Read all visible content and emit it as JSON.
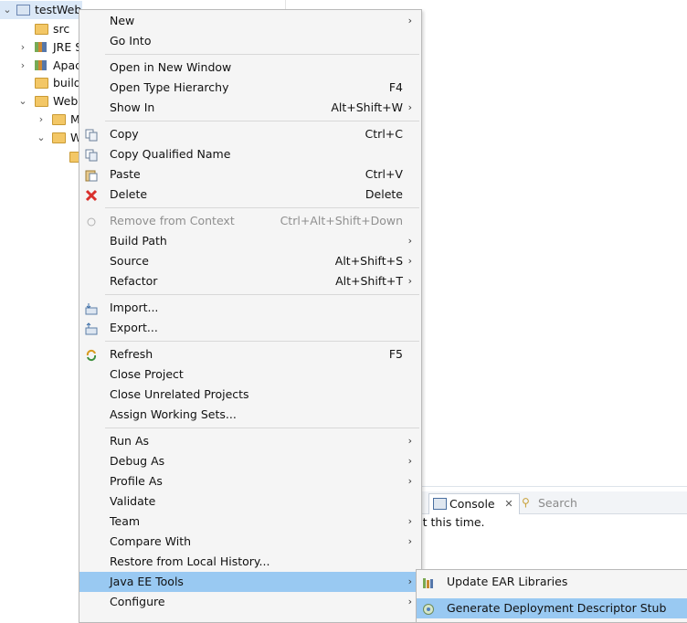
{
  "tree": {
    "items": [
      {
        "label": "testWeb",
        "twisty": "⌄"
      },
      {
        "label": "src",
        "twisty": ""
      },
      {
        "label": "JRE S",
        "twisty": "›"
      },
      {
        "label": "Apac",
        "twisty": "›"
      },
      {
        "label": "build",
        "twisty": ""
      },
      {
        "label": "Web",
        "twisty": "⌄"
      },
      {
        "label": "M",
        "twisty": "›"
      },
      {
        "label": "W",
        "twisty": "⌄"
      }
    ]
  },
  "bottom_panel": {
    "console_tab": "Console",
    "search_tab": "Search",
    "message": "at this time."
  },
  "menu": {
    "items": [
      {
        "label": "New",
        "accel": "",
        "submenu": true
      },
      {
        "label": "Go Into",
        "accel": "",
        "submenu": false
      },
      {
        "label": "Open in New Window",
        "accel": "",
        "submenu": false
      },
      {
        "label": "Open Type Hierarchy",
        "accel": "F4",
        "submenu": false
      },
      {
        "label": "Show In",
        "accel": "Alt+Shift+W",
        "submenu": true
      },
      {
        "label": "Copy",
        "accel": "Ctrl+C",
        "submenu": false
      },
      {
        "label": "Copy Qualified Name",
        "accel": "",
        "submenu": false
      },
      {
        "label": "Paste",
        "accel": "Ctrl+V",
        "submenu": false
      },
      {
        "label": "Delete",
        "accel": "Delete",
        "submenu": false
      },
      {
        "label": "Remove from Context",
        "accel": "Ctrl+Alt+Shift+Down",
        "submenu": false,
        "disabled": true
      },
      {
        "label": "Build Path",
        "accel": "",
        "submenu": true
      },
      {
        "label": "Source",
        "accel": "Alt+Shift+S",
        "submenu": true
      },
      {
        "label": "Refactor",
        "accel": "Alt+Shift+T",
        "submenu": true
      },
      {
        "label": "Import...",
        "accel": "",
        "submenu": false
      },
      {
        "label": "Export...",
        "accel": "",
        "submenu": false
      },
      {
        "label": "Refresh",
        "accel": "F5",
        "submenu": false
      },
      {
        "label": "Close Project",
        "accel": "",
        "submenu": false
      },
      {
        "label": "Close Unrelated Projects",
        "accel": "",
        "submenu": false
      },
      {
        "label": "Assign Working Sets...",
        "accel": "",
        "submenu": false
      },
      {
        "label": "Run As",
        "accel": "",
        "submenu": true
      },
      {
        "label": "Debug As",
        "accel": "",
        "submenu": true
      },
      {
        "label": "Profile As",
        "accel": "",
        "submenu": true
      },
      {
        "label": "Validate",
        "accel": "",
        "submenu": false
      },
      {
        "label": "Team",
        "accel": "",
        "submenu": true
      },
      {
        "label": "Compare With",
        "accel": "",
        "submenu": true
      },
      {
        "label": "Restore from Local History...",
        "accel": "",
        "submenu": false
      },
      {
        "label": "Java EE Tools",
        "accel": "",
        "submenu": true,
        "highlighted": true
      },
      {
        "label": "Configure",
        "accel": "",
        "submenu": true
      }
    ]
  },
  "submenu": {
    "items": [
      {
        "label": "Update EAR Libraries"
      },
      {
        "label": "Generate Deployment Descriptor Stub",
        "highlighted": true
      }
    ]
  },
  "colors": {
    "highlight": "#99c9f2",
    "menu_bg": "#f5f5f5",
    "delete_icon": "#d9302c"
  }
}
